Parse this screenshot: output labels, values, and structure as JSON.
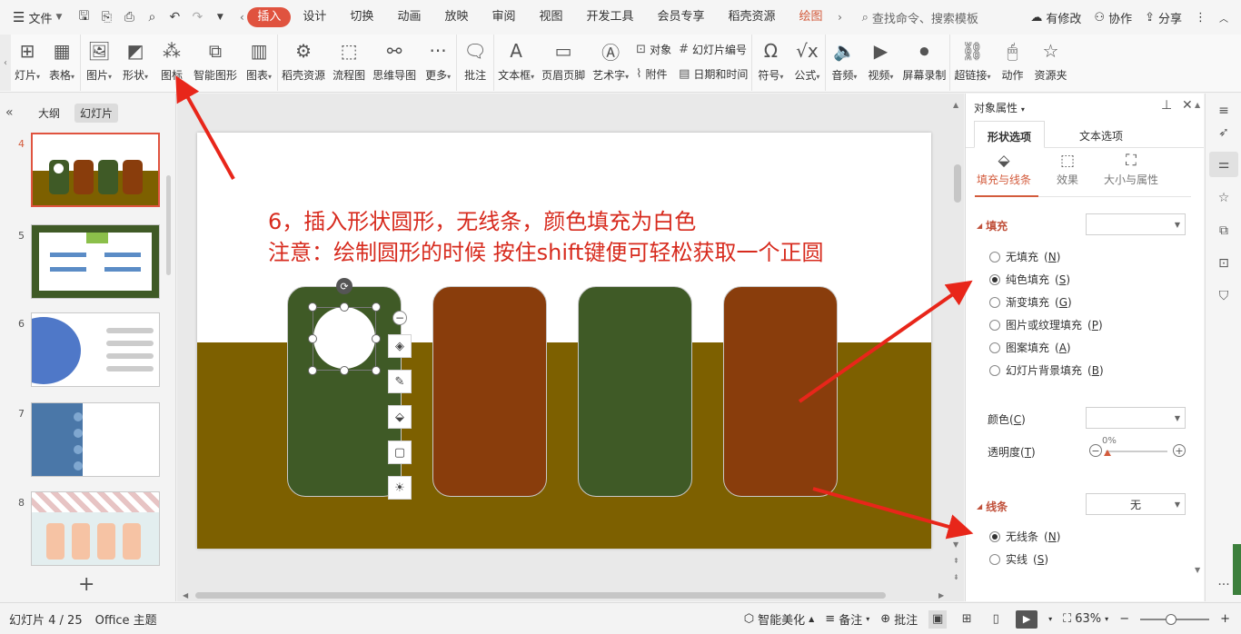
{
  "menubar": {
    "file_label": "文件",
    "tabs": [
      "插入",
      "设计",
      "切换",
      "动画",
      "放映",
      "审阅",
      "视图",
      "开发工具",
      "会员专享",
      "稻壳资源",
      "绘图"
    ],
    "search_placeholder": "查找命令、搜索模板",
    "right_actions": [
      "有修改",
      "协作",
      "分享"
    ]
  },
  "ribbon": {
    "b0": "灯片",
    "b1": "表格",
    "b2": "图片",
    "b3": "形状",
    "b4": "图标",
    "b5": "智能图形",
    "b6": "图表",
    "b7": "稻壳资源",
    "b8": "流程图",
    "b9": "思维导图",
    "b10": "更多",
    "b11": "批注",
    "b12": "文本框",
    "b13": "页眉页脚",
    "b14": "艺术字",
    "s1": "对象",
    "s2": "附件",
    "s3": "幻灯片编号",
    "s4": "日期和时间",
    "b15": "符号",
    "b16": "公式",
    "b17": "音频",
    "b18": "视频",
    "b19": "屏幕录制",
    "b20": "超链接",
    "b21": "动作",
    "b22": "资源夹"
  },
  "leftpanel": {
    "tab_outline": "大纲",
    "tab_slides": "幻灯片",
    "numbers": [
      "4",
      "5",
      "6",
      "7",
      "8"
    ],
    "add_symbol": "+"
  },
  "slide": {
    "line1": "6，插入形状圆形，无线条，颜色填充为白色",
    "line2": "注意：绘制圆形的时候 按住shift键便可轻松获取一个正圆"
  },
  "proppane": {
    "title": "对象属性",
    "tab_shape": "形状选项",
    "tab_text": "文本选项",
    "sub_fill_line": "填充与线条",
    "sub_effect": "效果",
    "sub_size": "大小与属性",
    "fill_section": "填充",
    "fill_options": [
      {
        "label": "无填充",
        "key": "N",
        "checked": false
      },
      {
        "label": "纯色填充",
        "key": "S",
        "checked": true
      },
      {
        "label": "渐变填充",
        "key": "G",
        "checked": false
      },
      {
        "label": "图片或纹理填充",
        "key": "P",
        "checked": false
      },
      {
        "label": "图案填充",
        "key": "A",
        "checked": false
      },
      {
        "label": "幻灯片背景填充",
        "key": "B",
        "checked": false
      }
    ],
    "color_label": "颜色",
    "color_key": "C",
    "transparency_label": "透明度",
    "transparency_key": "T",
    "transparency_value": "0%",
    "line_section": "线条",
    "line_dropdown": "无",
    "line_options": [
      {
        "label": "无线条",
        "key": "N",
        "checked": true
      },
      {
        "label": "实线",
        "key": "S",
        "checked": false
      }
    ]
  },
  "status": {
    "slide_info": "幻灯片 4 / 25",
    "theme": "Office 主题",
    "beautify": "智能美化",
    "notes": "备注",
    "comments": "批注",
    "zoom": "63%"
  },
  "colors": {
    "accent": "#e0533f",
    "slide_band": "#7d6000",
    "card_green": "#3f5a26",
    "card_brown": "#893d0c",
    "annotation_text": "#d72b1e"
  }
}
